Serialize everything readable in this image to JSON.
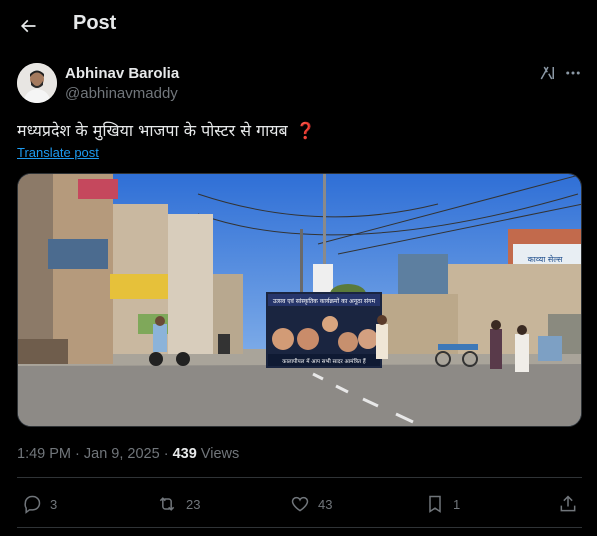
{
  "header": {
    "title": "Post",
    "back_icon": "arrow-left-icon"
  },
  "author": {
    "name": "Abhinav Barolia",
    "handle": "@abhinavmaddy"
  },
  "post": {
    "text": "मध्यप्रदेश के मुखिया भाजपा के पोस्टर से गायब",
    "emoji": "❓",
    "translate_label": "Translate post"
  },
  "media": {
    "banner_headline": "उत्सव एवं सांस्कृतिक कार्यक्रमों का अनूठा संगम",
    "banner_footer": "कालापीपल में आप सभी सादर आमंत्रित हैं",
    "shop_sign": "काव्या सेल्स"
  },
  "meta": {
    "time": "1:49 PM",
    "sep": " · ",
    "date": "Jan 9, 2025",
    "dot": " · ",
    "views_count": "439",
    "views_label": " Views"
  },
  "actions": {
    "replies": "3",
    "reposts": "23",
    "likes": "43",
    "bookmarks": "1"
  },
  "colors": {
    "background": "#000000",
    "text": "#e7e9ea",
    "muted": "#71767b",
    "link": "#1d9bf0",
    "divider": "#2f3336"
  }
}
